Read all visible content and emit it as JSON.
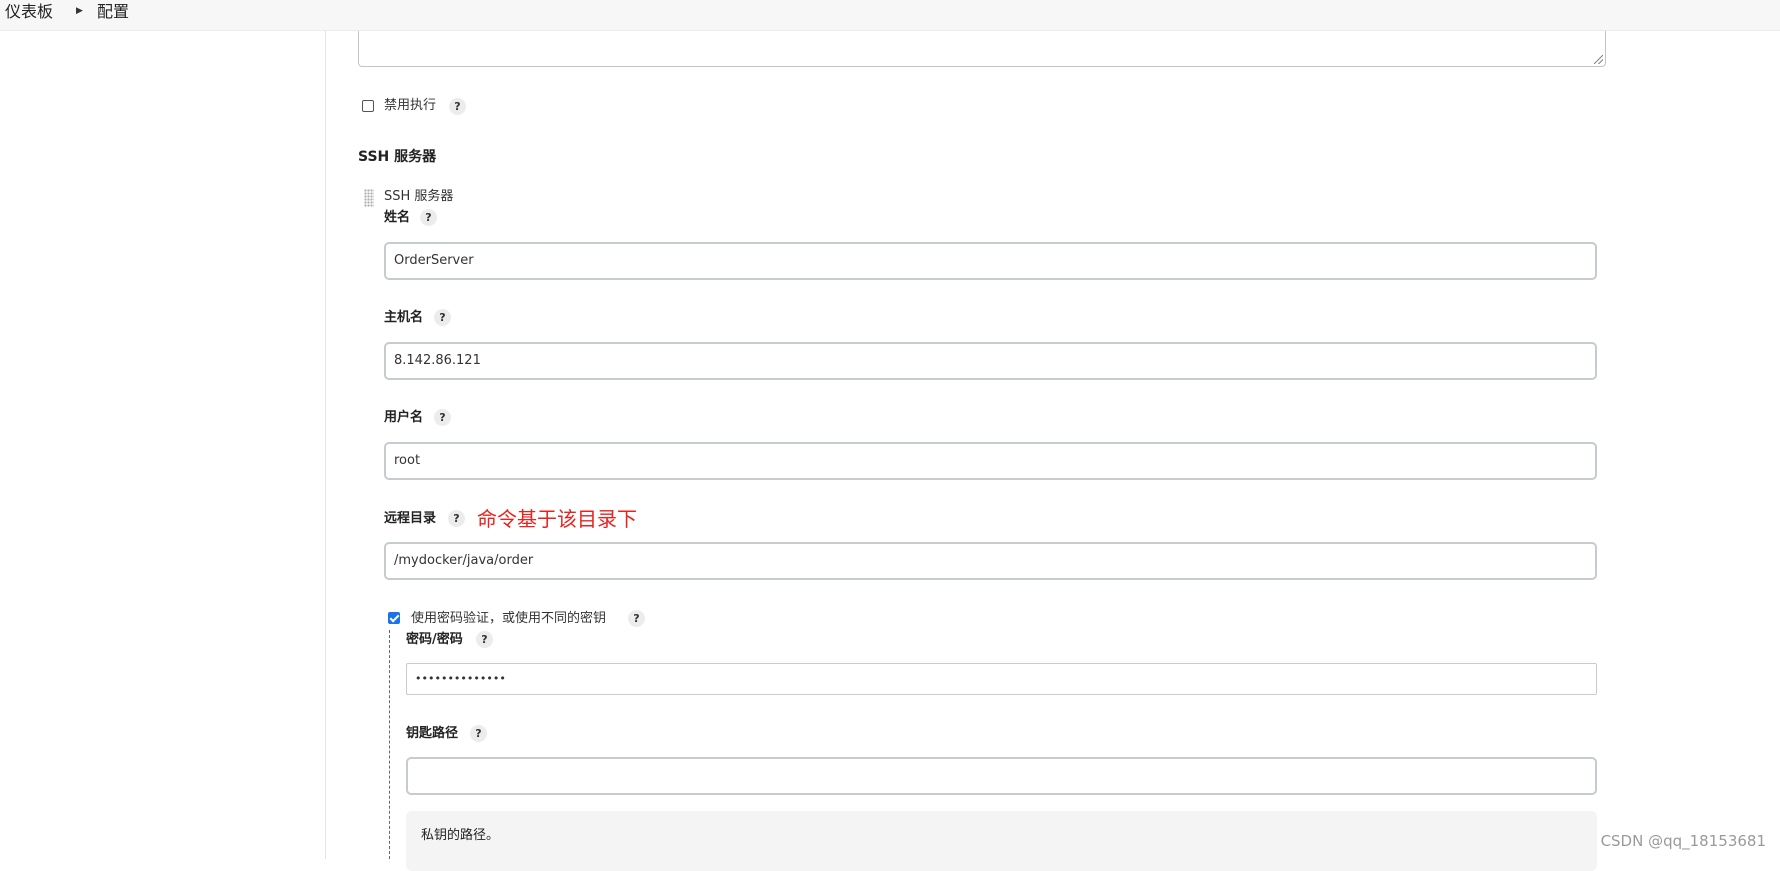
{
  "breadcrumb": {
    "home": "仪表板",
    "separator": "›",
    "current": "配置"
  },
  "disable_exec": {
    "label": "禁用执行",
    "help": "?",
    "checked": false
  },
  "ssh_section": {
    "title": "SSH 服务器",
    "item_title": "SSH 服务器"
  },
  "fields": {
    "name": {
      "label": "姓名",
      "help": "?",
      "value": "OrderServer"
    },
    "hostname": {
      "label": "主机名",
      "help": "?",
      "value": "8.142.86.121"
    },
    "username": {
      "label": "用户名",
      "help": "?",
      "value": "root"
    },
    "remote_dir": {
      "label": "远程目录",
      "help": "?",
      "value": "/mydocker/java/order"
    }
  },
  "annotation": "命令基于该目录下",
  "password_auth": {
    "label": "使用密码验证，或使用不同的密钥",
    "help": "?",
    "checked": true,
    "password_label": "密码/密码",
    "password_help": "?",
    "password_value": "••••••••••••••",
    "key_path_label": "钥匙路径",
    "key_path_help": "?",
    "key_path_value": "",
    "help_text": "私钥的路径。"
  },
  "watermark": "CSDN @qq_18153681",
  "colors": {
    "annotation": "#e8231f",
    "checkbox_checked": "#1a73e8",
    "input_border": "#c6cbd0"
  }
}
